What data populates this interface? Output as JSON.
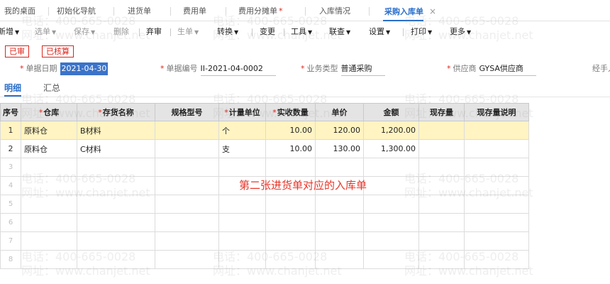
{
  "tabs": [
    {
      "label": "我的桌面",
      "required": false,
      "active": false
    },
    {
      "label": "初始化导航",
      "required": false,
      "active": false
    },
    {
      "label": "进货单",
      "required": false,
      "active": false
    },
    {
      "label": "费用单",
      "required": false,
      "active": false
    },
    {
      "label": "费用分摊单",
      "required": true,
      "active": false
    },
    {
      "label": "入库情况",
      "required": false,
      "active": false
    },
    {
      "label": "采购入库单",
      "required": false,
      "active": true
    }
  ],
  "tab_close_glyph": "×",
  "toolbar": [
    {
      "label": "新增",
      "dropdown": true,
      "disabled": false
    },
    {
      "label": "选单",
      "dropdown": true,
      "disabled": true
    },
    {
      "label": "保存",
      "dropdown": true,
      "disabled": true
    },
    {
      "label": "删除",
      "dropdown": false,
      "disabled": true
    },
    {
      "label": "弃审",
      "dropdown": false,
      "disabled": false
    },
    {
      "label": "生单",
      "dropdown": true,
      "disabled": true
    },
    {
      "label": "转换",
      "dropdown": true,
      "disabled": false
    },
    {
      "label": "变更",
      "dropdown": false,
      "disabled": false
    },
    {
      "label": "工具",
      "dropdown": true,
      "disabled": false
    },
    {
      "label": "联查",
      "dropdown": true,
      "disabled": false
    },
    {
      "label": "设置",
      "dropdown": true,
      "disabled": false
    },
    {
      "label": "打印",
      "dropdown": true,
      "disabled": false
    },
    {
      "label": "更多",
      "dropdown": true,
      "disabled": false
    }
  ],
  "stamps": [
    "已审",
    "已核算"
  ],
  "header_fields": {
    "date": {
      "label": "单据日期",
      "value": "2021-04-30"
    },
    "code": {
      "label": "单据编号",
      "value": "II-2021-04-0002"
    },
    "biz_type": {
      "label": "业务类型",
      "value": "普通采购"
    },
    "supplier": {
      "label": "供应商",
      "value": "GYSA供应商"
    },
    "handler_partial": "经手人"
  },
  "detail_tabs": [
    "明细",
    "汇总"
  ],
  "grid": {
    "columns": [
      {
        "label": "序号",
        "required": false
      },
      {
        "label": "仓库",
        "required": true
      },
      {
        "label": "存货名称",
        "required": true
      },
      {
        "label": "规格型号",
        "required": false
      },
      {
        "label": "计量单位",
        "required": true
      },
      {
        "label": "实收数量",
        "required": true
      },
      {
        "label": "单价",
        "required": false
      },
      {
        "label": "金额",
        "required": false
      },
      {
        "label": "现存量",
        "required": false
      },
      {
        "label": "现存量说明",
        "required": false
      }
    ],
    "rows": [
      {
        "idx": "1",
        "warehouse": "原料仓",
        "item": "B材料",
        "spec": "",
        "unit": "个",
        "qty": "10.00",
        "price": "120.00",
        "amount": "1,200.00",
        "stock": "",
        "stock_note": ""
      },
      {
        "idx": "2",
        "warehouse": "原料仓",
        "item": "C材料",
        "spec": "",
        "unit": "支",
        "qty": "10.00",
        "price": "130.00",
        "amount": "1,300.00",
        "stock": "",
        "stock_note": ""
      },
      {
        "idx": "3"
      },
      {
        "idx": "4"
      },
      {
        "idx": "5"
      },
      {
        "idx": "6"
      },
      {
        "idx": "7"
      },
      {
        "idx": "8"
      }
    ],
    "selected_row": 0
  },
  "annotation": "第二张进货单对应的入库单",
  "watermark": {
    "phone": "电话：400-665-0028",
    "url": "网址：www.chanjet.net"
  },
  "colors": {
    "accent": "#2a6fcb",
    "required": "#e2231a",
    "stamp": "#d9251c",
    "selected_row": "#fff4c2",
    "annotation": "#e8362a"
  }
}
